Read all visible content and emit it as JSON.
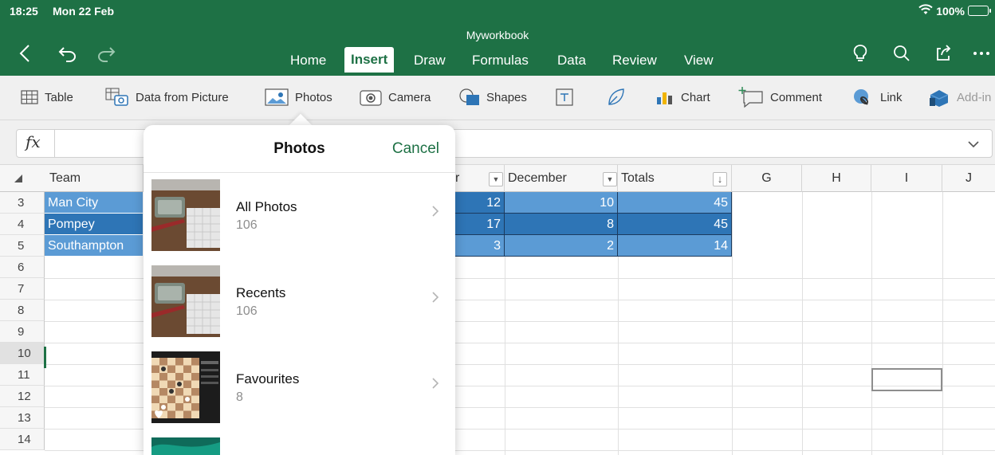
{
  "status": {
    "time": "18:25",
    "date": "Mon 22 Feb",
    "battery": "100%"
  },
  "doc": {
    "title": "Myworkbook"
  },
  "tabs": [
    {
      "label": "Home"
    },
    {
      "label": "Insert"
    },
    {
      "label": "Draw"
    },
    {
      "label": "Formulas"
    },
    {
      "label": "Data"
    },
    {
      "label": "Review"
    },
    {
      "label": "View"
    }
  ],
  "ribbon": {
    "table": "Table",
    "data_from_picture": "Data from Picture",
    "photos": "Photos",
    "camera": "Camera",
    "shapes": "Shapes",
    "chart": "Chart",
    "comment": "Comment",
    "link": "Link",
    "addins": "Add-in"
  },
  "formula": {
    "label": "fx"
  },
  "grid": {
    "columns": {
      "a": "Team",
      "nov_partial": "r",
      "dec": "December",
      "totals": "Totals",
      "g": "G",
      "h": "H",
      "i": "I",
      "j": "J"
    },
    "row_numbers": [
      "3",
      "4",
      "5",
      "6",
      "7",
      "8",
      "9",
      "10",
      "11",
      "12",
      "13",
      "14"
    ],
    "rows": [
      {
        "team": "Man City",
        "nov": "12",
        "dec": "10",
        "total": "45"
      },
      {
        "team": "Pompey",
        "nov": "17",
        "dec": "8",
        "total": "45"
      },
      {
        "team": "Southampton",
        "nov": "3",
        "dec": "2",
        "total": "14"
      }
    ]
  },
  "popover": {
    "title": "Photos",
    "cancel": "Cancel",
    "albums": [
      {
        "name": "All Photos",
        "count": "106"
      },
      {
        "name": "Recents",
        "count": "106"
      },
      {
        "name": "Favourites",
        "count": "8"
      }
    ]
  },
  "colors": {
    "header_green": "#1e7145",
    "table_blue": "#5b9bd5",
    "table_dark_blue": "#2e75b6"
  }
}
